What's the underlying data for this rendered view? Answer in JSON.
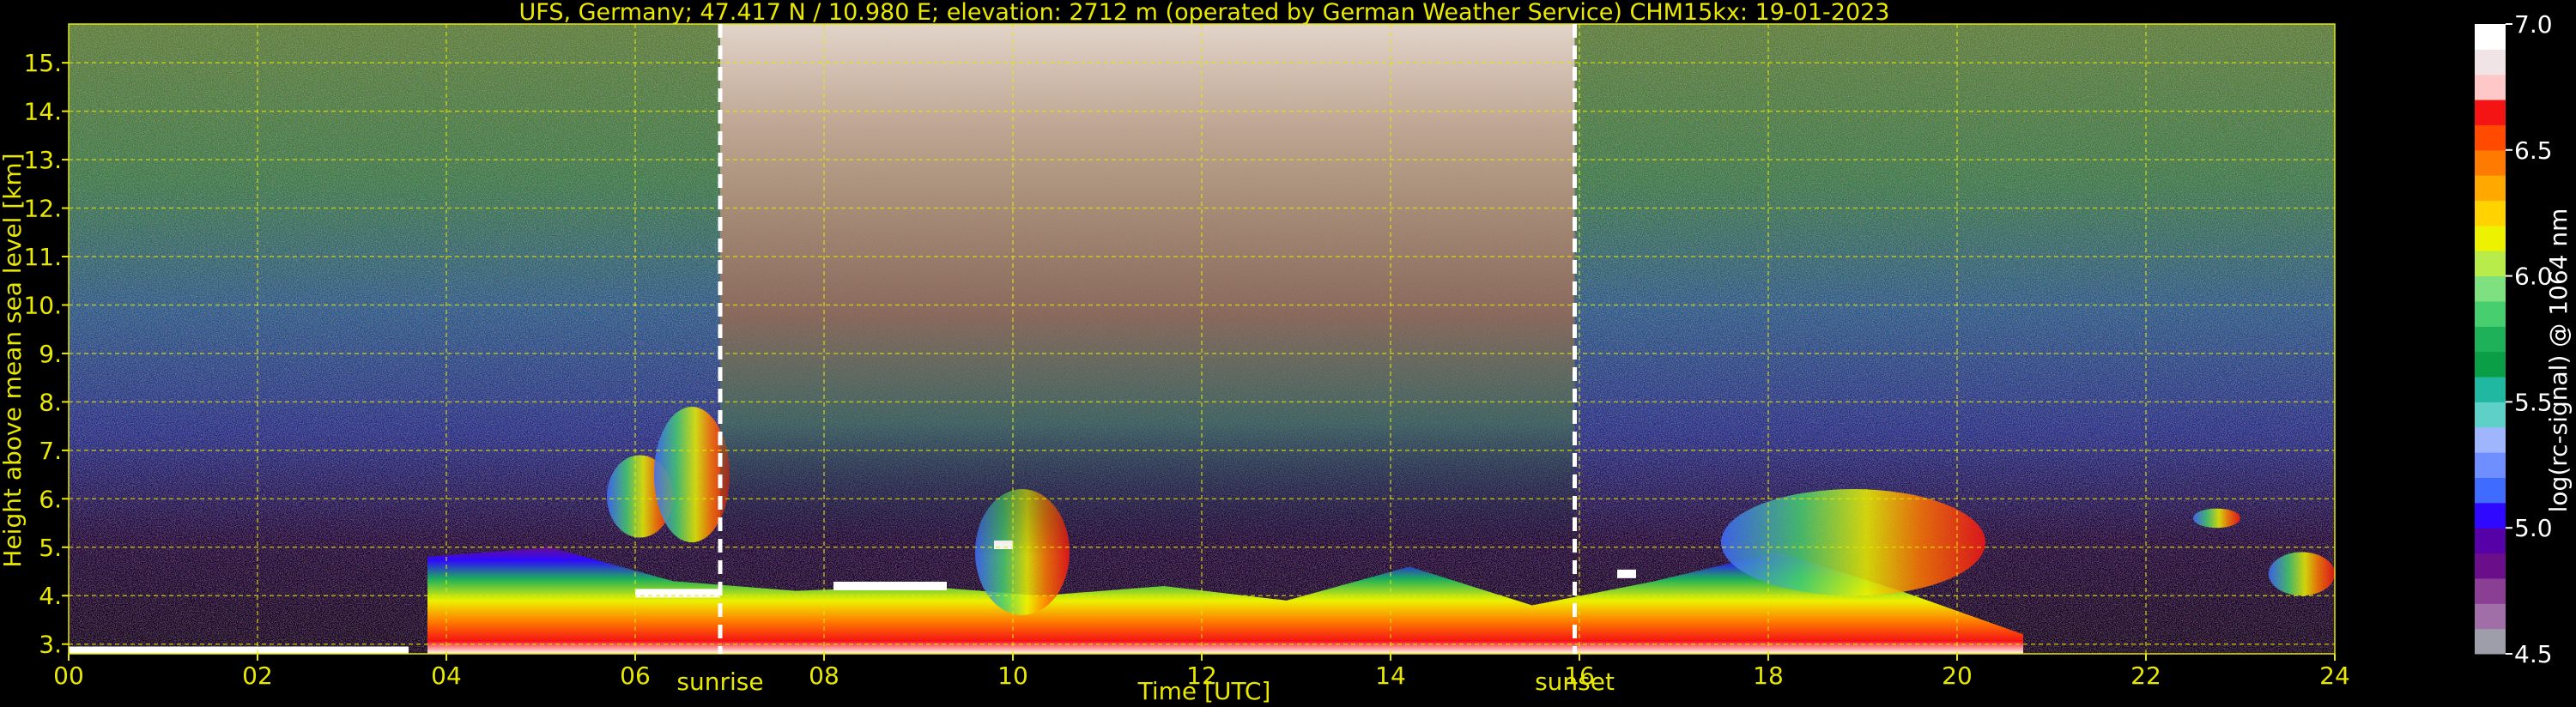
{
  "chart_data": {
    "type": "heatmap",
    "title": "UFS, Germany; 47.417 N / 10.980 E; elevation: 2712 m  (operated by German Weather Service)    CHM15kx: 19-01-2023",
    "xlabel": "Time [UTC]",
    "ylabel": "Height above mean sea level [km]",
    "xlim": [
      0,
      24
    ],
    "ylim": [
      2.8,
      15.8
    ],
    "x_ticks": [
      0,
      2,
      4,
      6,
      8,
      10,
      12,
      14,
      16,
      18,
      20,
      22,
      24
    ],
    "x_tick_labels": [
      "00",
      "02",
      "04",
      "06",
      "08",
      "10",
      "12",
      "14",
      "16",
      "18",
      "20",
      "22",
      "24"
    ],
    "y_ticks": [
      3,
      4,
      5,
      6,
      7,
      8,
      9,
      10,
      11,
      12,
      13,
      14,
      15
    ],
    "y_tick_labels": [
      "3.",
      "4.",
      "5.",
      "6.",
      "7.",
      "8.",
      "9.",
      "10.",
      "11.",
      "12.",
      "13.",
      "14.",
      "15."
    ],
    "grid": true,
    "annotations": [
      {
        "x": 6.9,
        "label": "sunrise"
      },
      {
        "x": 15.95,
        "label": "sunset"
      }
    ],
    "colorbar": {
      "label": "log(rc-signal) @ 1064 nm",
      "range": [
        4.5,
        7.0
      ],
      "ticks": [
        4.5,
        5.0,
        5.5,
        6.0,
        6.5,
        7.0
      ],
      "tick_labels": [
        "4.5",
        "5.0",
        "5.5",
        "6.0",
        "6.5",
        "7.0"
      ],
      "colors": [
        "#9e9eab",
        "#a06fa7",
        "#8a3f95",
        "#6a0e8a",
        "#5600a8",
        "#2e08ff",
        "#3f6cff",
        "#6f8eff",
        "#9fb6ff",
        "#5fd0c8",
        "#20b8a0",
        "#0a9e46",
        "#1fb05a",
        "#47cf6f",
        "#7fe07f",
        "#b8ec4a",
        "#ecf200",
        "#ffd200",
        "#ffa800",
        "#ff7a00",
        "#ff4a00",
        "#f51414",
        "#ffc8c8",
        "#f0e4e6",
        "#ffffff"
      ]
    },
    "series": [
      {
        "kind": "surface_signal",
        "x": [
          0,
          3.6
        ],
        "y_top": 2.95,
        "level": 7.0
      },
      {
        "kind": "boundary_layer",
        "x": [
          3.8,
          20.7
        ],
        "y_top": [
          4.8,
          5.0,
          4.3,
          4.1,
          4.2,
          4.0,
          4.2,
          3.9,
          4.6,
          3.8,
          4.3,
          4.9,
          4.1,
          3.2
        ],
        "level": 6.5
      },
      {
        "kind": "cloud_layer",
        "x": [
          5.7,
          6.4
        ],
        "y_range": [
          5.2,
          6.9
        ],
        "level": 6.0
      },
      {
        "kind": "cloud_layer",
        "x": [
          6.2,
          7.0
        ],
        "y_range": [
          5.1,
          7.9
        ],
        "level": 6.0
      },
      {
        "kind": "cloud_layer",
        "x": [
          9.6,
          10.6
        ],
        "y_range": [
          3.6,
          6.2
        ],
        "level": 6.5
      },
      {
        "kind": "cloud_layer",
        "x": [
          17.5,
          20.3
        ],
        "y_range": [
          4.0,
          6.2
        ],
        "level": 5.8
      },
      {
        "kind": "cloud_layer",
        "x": [
          23.3,
          24.0
        ],
        "y_range": [
          4.0,
          4.9
        ],
        "level": 5.8
      },
      {
        "kind": "cloud_layer",
        "x": [
          22.5,
          23.0
        ],
        "y_range": [
          5.4,
          5.8
        ],
        "level": 5.5
      },
      {
        "kind": "white_band",
        "x": [
          6.0,
          6.9
        ],
        "y": 4.05,
        "level": 7.0
      },
      {
        "kind": "white_band",
        "x": [
          8.1,
          9.3
        ],
        "y": 4.2,
        "level": 7.0
      },
      {
        "kind": "white_band",
        "x": [
          9.8,
          10.0
        ],
        "y": 5.05,
        "level": 7.0
      },
      {
        "kind": "white_band",
        "x": [
          16.4,
          16.6
        ],
        "y": 4.45,
        "level": 7.0
      },
      {
        "kind": "daylight_noise",
        "x": [
          6.9,
          15.95
        ],
        "y_range": [
          8.0,
          15.8
        ],
        "level": 6.5
      }
    ]
  }
}
